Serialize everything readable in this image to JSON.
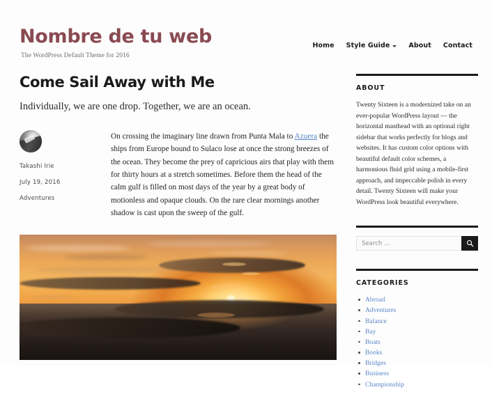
{
  "header": {
    "site_title": "Nombre de tu web",
    "tagline": "The WordPress Default Theme for 2016",
    "nav": [
      {
        "label": "Home",
        "has_dropdown": false
      },
      {
        "label": "Style Guide",
        "has_dropdown": true
      },
      {
        "label": "About",
        "has_dropdown": false
      },
      {
        "label": "Contact",
        "has_dropdown": false
      }
    ]
  },
  "post": {
    "title": "Come Sail Away with Me",
    "subtitle": "Individually, we are one drop. Together, we are an ocean.",
    "author": "Takashi Irie",
    "date": "July 19, 2016",
    "category": "Adventures",
    "body_part1": "On crossing the imaginary line drawn from Punta Mala to ",
    "body_link": "Azuera",
    "body_part2": " the ships from Europe bound to Sulaco lose at once the strong breezes of the ocean. They become the prey of capricious airs that play with them for thirty hours at a stretch sometimes. Before them the head of the calm gulf is filled on most days of the year by a great body of motionless and opaque clouds. On the rare clear mornings another shadow is cast upon the sweep of the gulf."
  },
  "sidebar": {
    "about": {
      "title": "ABOUT",
      "text": "Twenty Sixteen is a modernized take on an ever-popular WordPress layout — the horizontal masthead with an optional right sidebar that works perfectly for blogs and websites. It has custom color options with beautiful default color schemes, a harmonious fluid grid using a mobile-first approach, and impeccable polish in every detail. Twenty Sixteen will make your WordPress look beautiful everywhere."
    },
    "search": {
      "placeholder": "Search …",
      "value": ""
    },
    "categories": {
      "title": "CATEGORIES",
      "items": [
        "Abroad",
        "Adventures",
        "Balance",
        "Bay",
        "Boats",
        "Books",
        "Bridges",
        "Business",
        "Championship"
      ]
    }
  },
  "colors": {
    "site_title": "#8a4a52",
    "link": "#5a86c7",
    "text": "#1a1a1a",
    "search_button": "#1a1a1a"
  }
}
